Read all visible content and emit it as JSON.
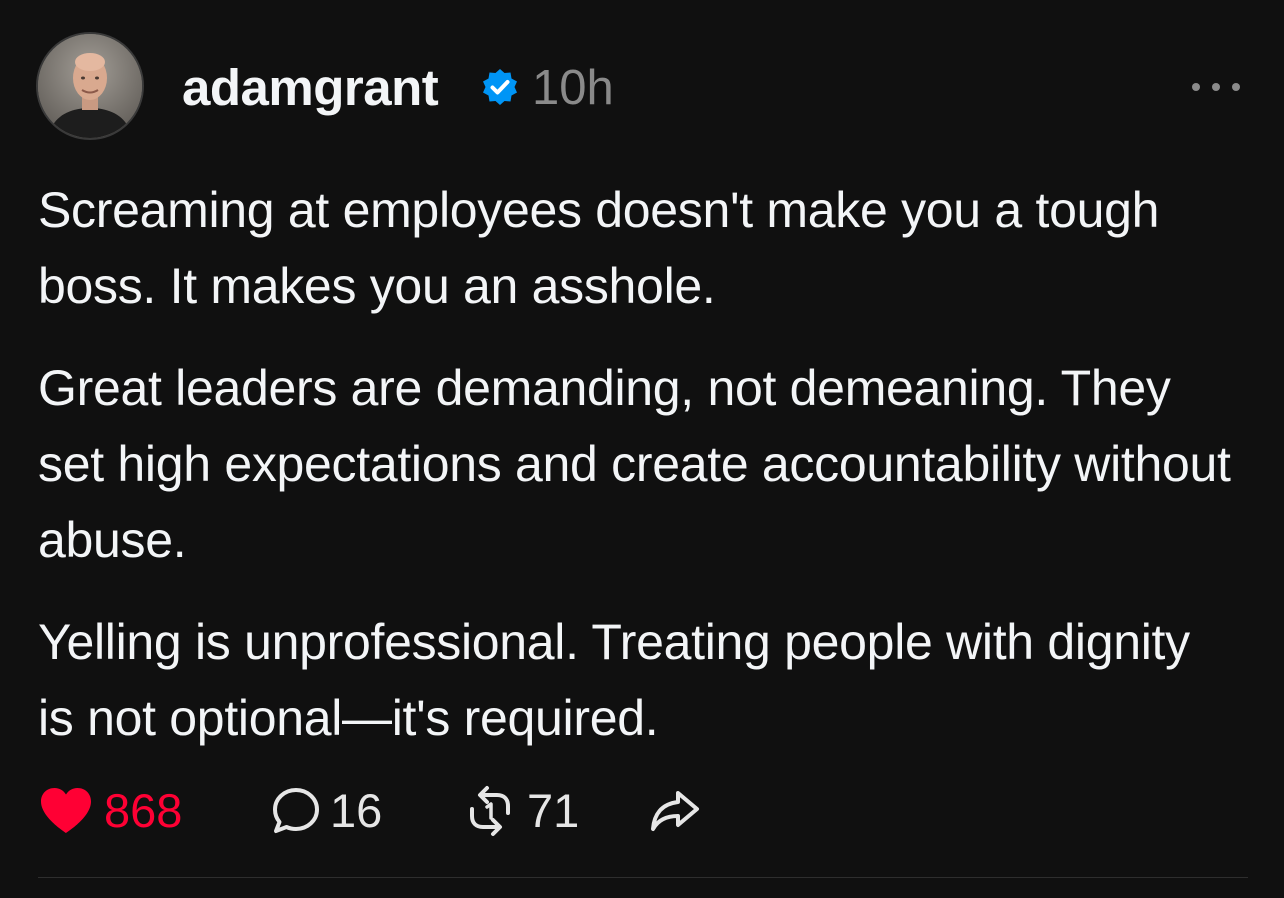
{
  "post": {
    "username": "adamgrant",
    "verified_icon": "verified-badge-icon",
    "timestamp": "10h",
    "more_icon": "more-options-icon",
    "paragraphs": [
      "Screaming at employees doesn't make you a tough boss. It makes you an asshole.",
      "Great leaders are demanding, not demeaning. They set high expectations and create accountability without abuse.",
      "Yelling is unprofessional. Treating people with dignity is not optional—it's required."
    ],
    "actions": {
      "likes": "868",
      "replies": "16",
      "reposts": "71"
    }
  },
  "colors": {
    "background": "#101010",
    "text": "#f3f5f7",
    "muted": "#8a8a8a",
    "like_red": "#ff0034",
    "verified_blue": "#0095f6"
  }
}
